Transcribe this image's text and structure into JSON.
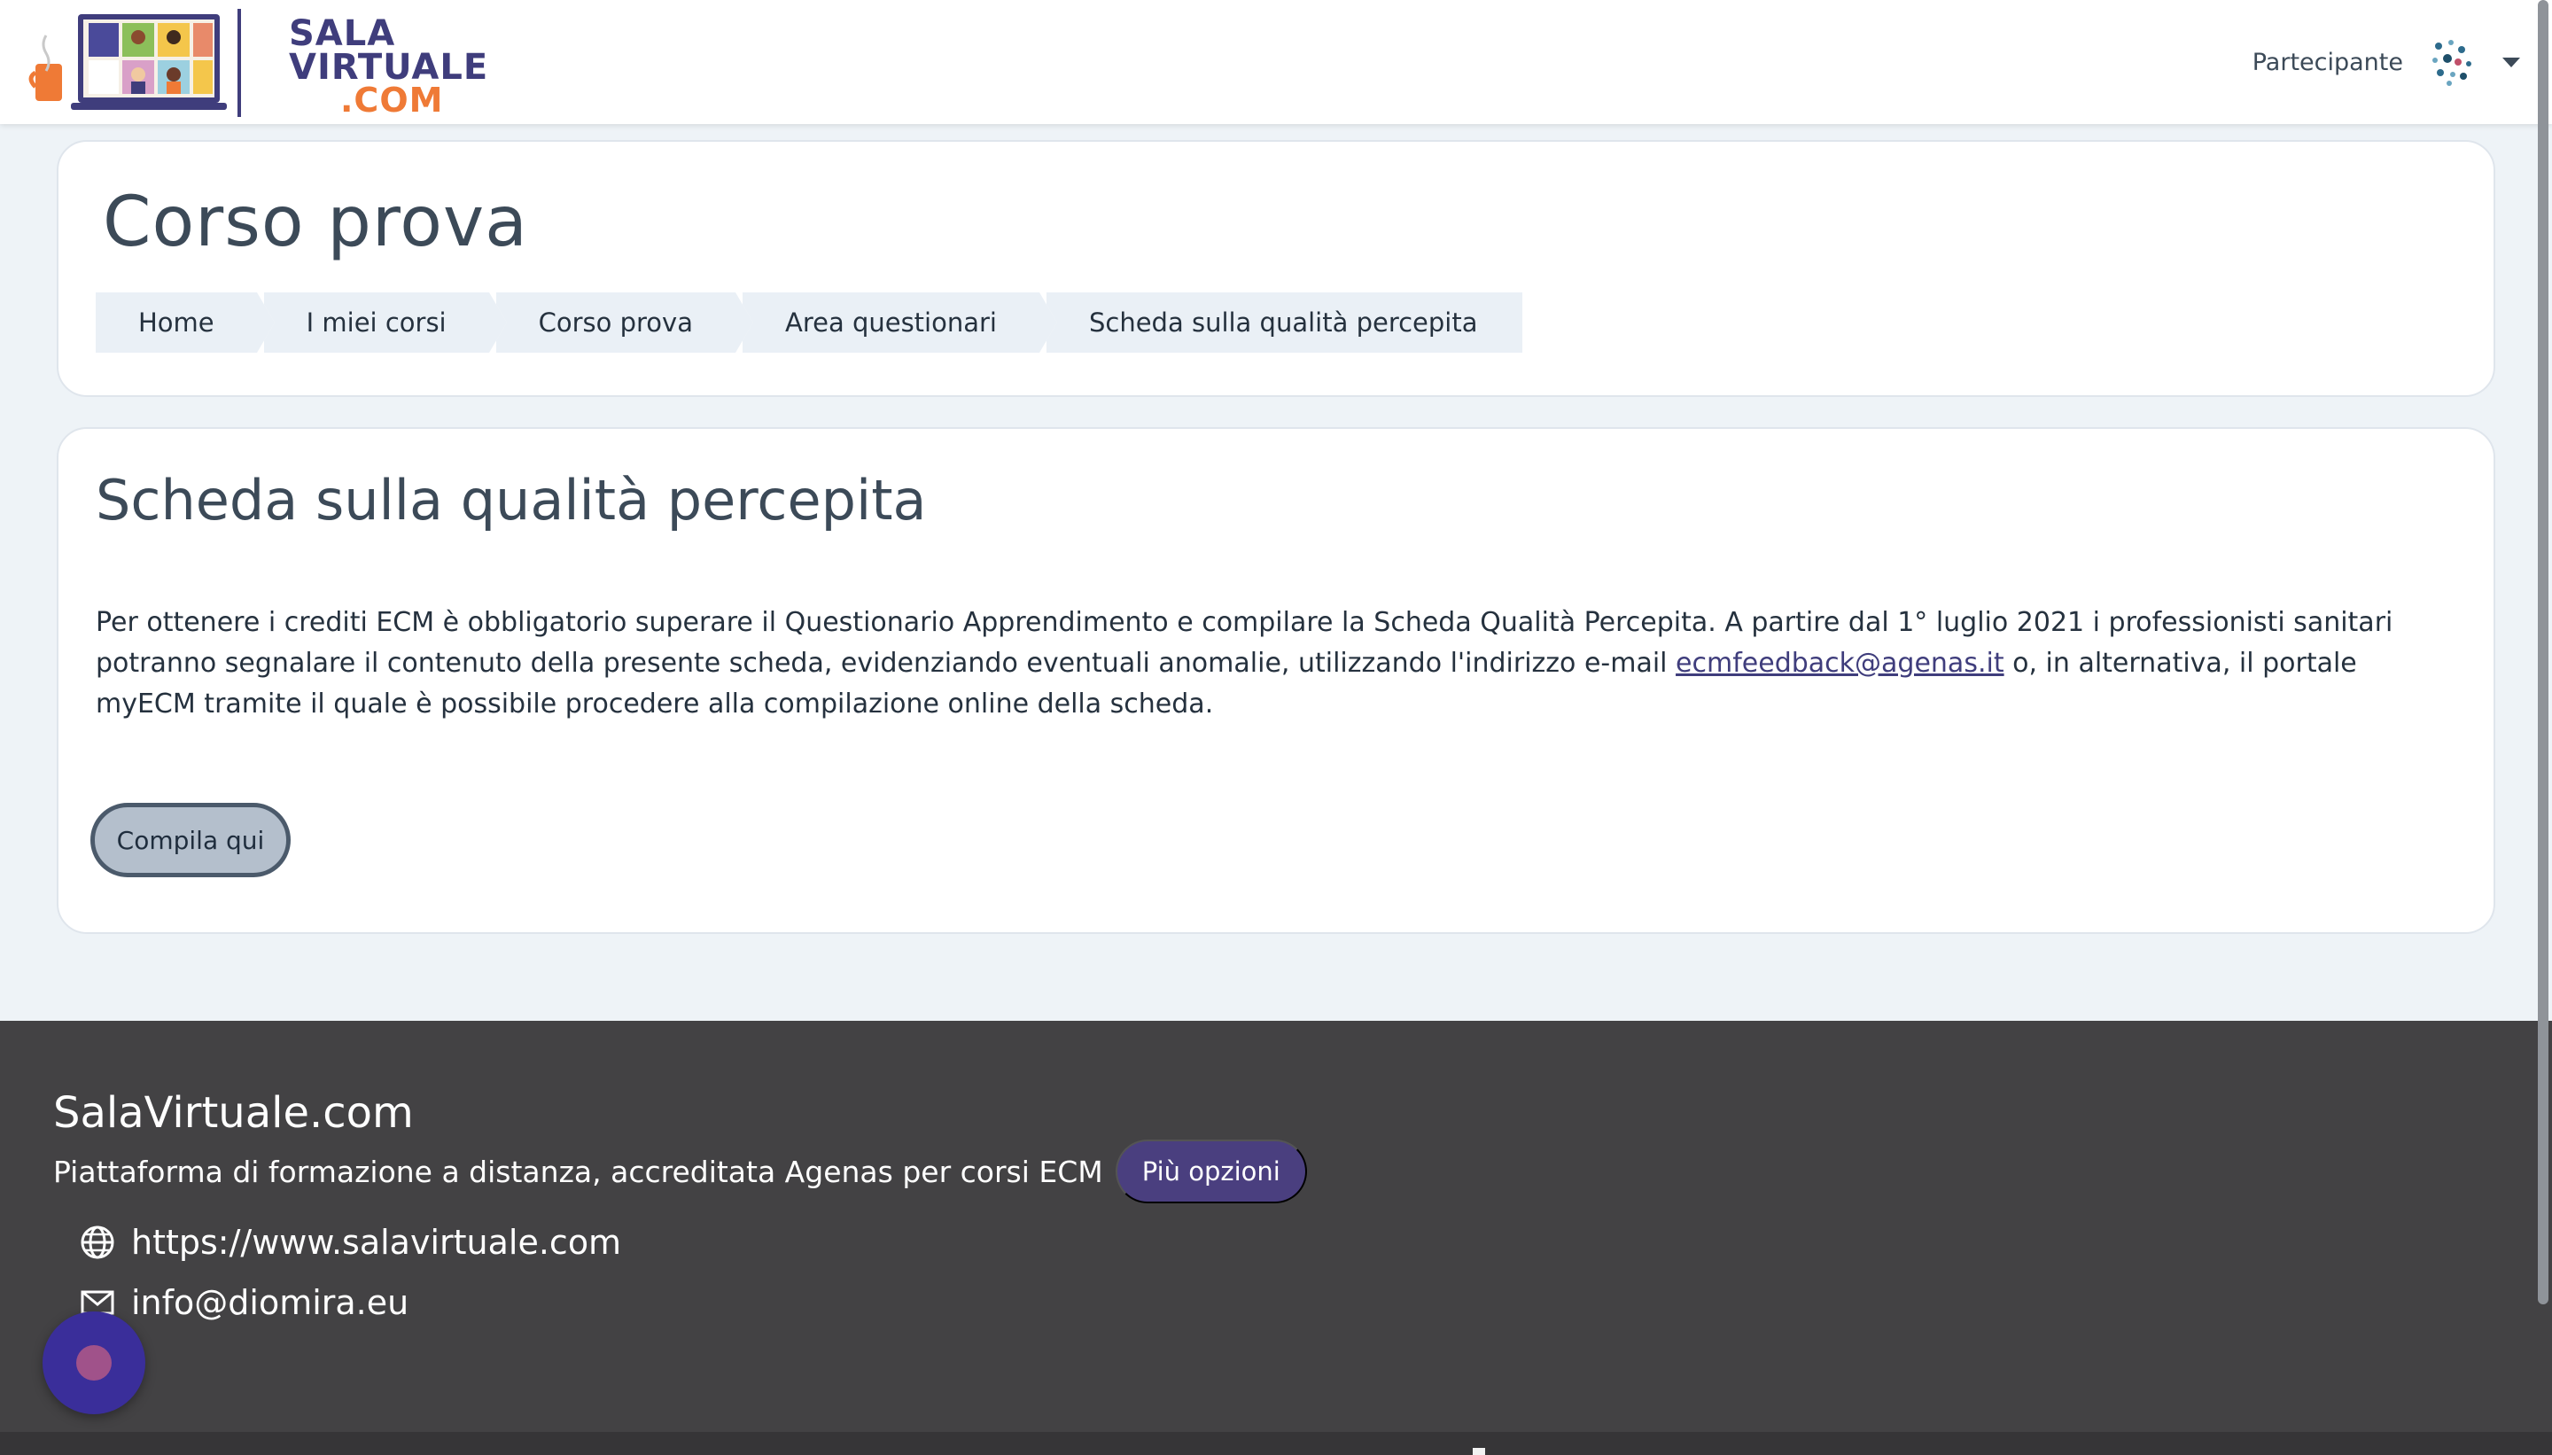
{
  "brand": {
    "logo_line1": "SALA",
    "logo_line2": "VIRTUALE",
    "logo_line3": ".COM",
    "colors": {
      "primary": "#3f3d7c",
      "accent": "#ef7a36"
    }
  },
  "user": {
    "role": "Partecipante",
    "avatar_icon": "avatar-molecule-icon",
    "menu_icon": "caret-down-icon"
  },
  "header": {
    "course_title": "Corso prova",
    "breadcrumb": [
      {
        "label": "Home"
      },
      {
        "label": "I miei corsi"
      },
      {
        "label": "Corso prova"
      },
      {
        "label": "Area questionari"
      },
      {
        "label": "Scheda sulla qualità percepita"
      }
    ]
  },
  "content": {
    "title": "Scheda sulla qualità percepita",
    "intro_part1": "Per ottenere i crediti ECM è obbligatorio superare il Questionario Apprendimento e compilare la Scheda Qualità Percepita. A partire dal 1° luglio 2021 i professionisti sanitari potranno segnalare il contenuto della presente scheda, evidenziando eventuali anomalie, utilizzando l'indirizzo e-mail ",
    "intro_link": "ecmfeedback@agenas.it",
    "intro_part2": " o, in alternativa, il portale myECM tramite il quale è possibile procedere alla compilazione online della scheda.",
    "button_label": "Compila qui"
  },
  "footer": {
    "brand": "SalaVirtuale.com",
    "description": "Piattaforma di formazione a distanza, accreditata Agenas per corsi ECM",
    "more_button": "Più opzioni",
    "website": "https://www.salavirtuale.com",
    "email": "info@diomira.eu",
    "background": "#434244"
  }
}
